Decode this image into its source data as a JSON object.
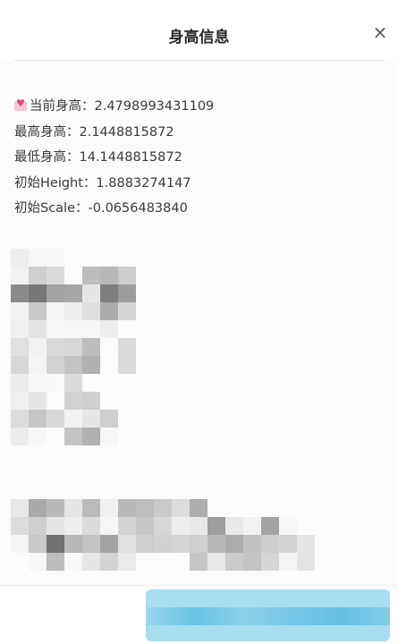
{
  "dialog": {
    "title": "身高信息",
    "close_glyph": "×"
  },
  "info": {
    "current_height": "当前身高：2.4798993431109",
    "max_height": "最高身高：2.1448815872",
    "min_height": "最低身高：14.1448815872",
    "initial_height": "初始Height：1.8883274147",
    "initial_scale": "初始Scale：-0.0656483840"
  },
  "icons": {
    "current_height_icon": "heart-icon"
  },
  "colors": {
    "confirm_button": "#a8dcef",
    "confirm_button_accent": "#5ec1e2"
  }
}
